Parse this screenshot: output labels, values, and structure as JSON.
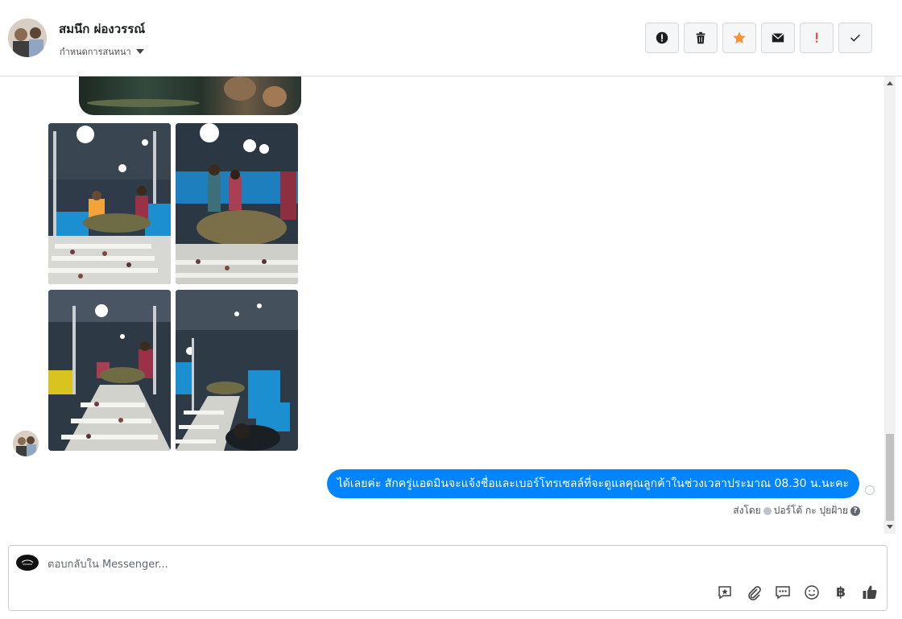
{
  "header": {
    "contact_name": "สมนึก ผ่องวรรณ์",
    "assign_label": "กำหนดการสนทนา",
    "actions": [
      {
        "name": "spam-button",
        "icon": "alert-circle-icon"
      },
      {
        "name": "delete-button",
        "icon": "trash-icon"
      },
      {
        "name": "star-button",
        "icon": "star-icon"
      },
      {
        "name": "mark-unread-button",
        "icon": "envelope-icon"
      },
      {
        "name": "follow-up-button",
        "icon": "exclamation-icon"
      },
      {
        "name": "mark-done-button",
        "icon": "check-icon"
      }
    ]
  },
  "conversation": {
    "outgoing_message": "ได้เลยค่ะ สักครู่แอดมินจะแจ้งชื่อและเบอร์โทรเซลล์ที่จะดูแลคุณลูกค้าในช่วงเวลาประมาณ 08.30 น.นะคะ",
    "sent_by_prefix": "ส่งโดย",
    "sent_by_name": "ปอร์โต้ กะ ปุยฝ้าย"
  },
  "composer": {
    "placeholder": "ตอบกลับใน Messenger...",
    "baht_symbol": "฿"
  },
  "colors": {
    "accent": "#0084ff",
    "star": "#f7923a",
    "alert": "#fa3e3e"
  }
}
